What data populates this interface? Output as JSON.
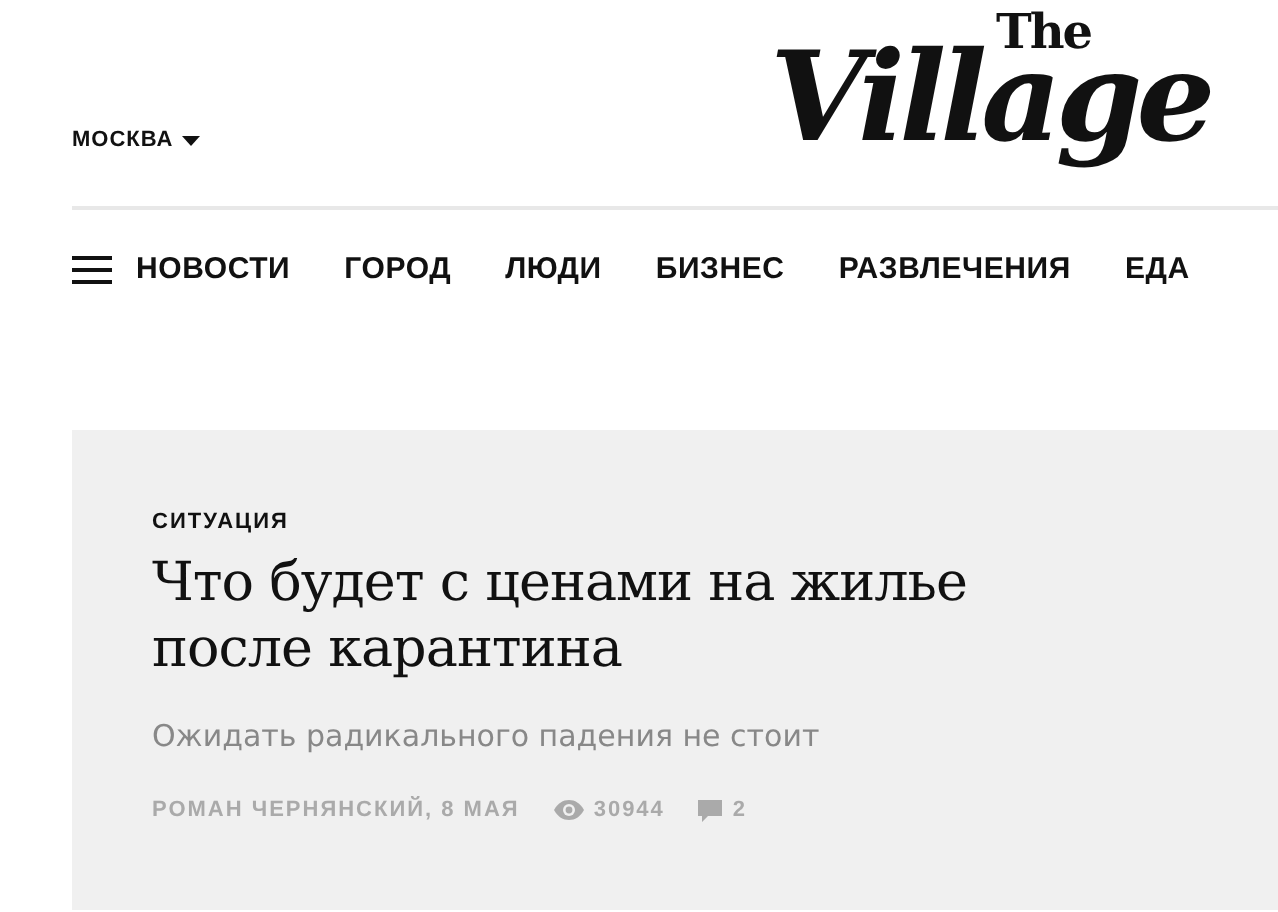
{
  "header": {
    "city": "МОСКВА",
    "logo": {
      "small": "The",
      "main": "Village"
    }
  },
  "nav": {
    "items": [
      "НОВОСТИ",
      "ГОРОД",
      "ЛЮДИ",
      "БИЗНЕС",
      "РАЗВЛЕЧЕНИЯ",
      "ЕДА"
    ]
  },
  "article": {
    "category": "СИТУАЦИЯ",
    "title": "Что будет с ценами на жилье после карантина",
    "subtitle": "Ожидать радикального падения не стоит",
    "byline": "РОМАН ЧЕРНЯНСКИЙ, 8 МАЯ",
    "views": "30944",
    "comments": "2"
  }
}
